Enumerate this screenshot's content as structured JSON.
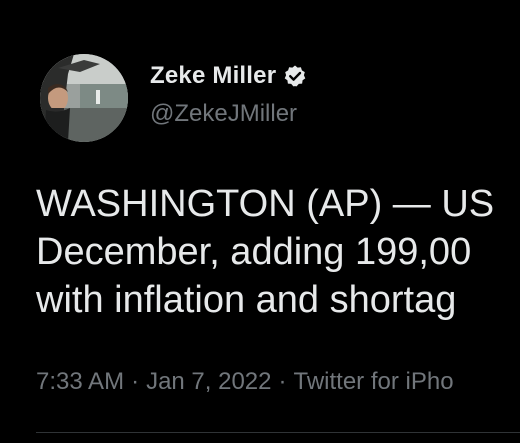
{
  "author": {
    "display_name": "Zeke Miller",
    "handle": "@ZekeJMiller",
    "verified_icon": "verified-badge-icon",
    "avatar_icon": "profile-photo"
  },
  "tweet": {
    "lines": [
      "WASHINGTON (AP) — US",
      "December, adding 199,00",
      "with inflation and shortag"
    ]
  },
  "meta": {
    "time": "7:33 AM",
    "separator": "·",
    "date": "Jan 7, 2022",
    "source": "Twitter for iPho"
  },
  "colors": {
    "background": "#000000",
    "primary_text": "#e7e9ea",
    "secondary_text": "#71767b",
    "divider": "#2f3336"
  }
}
